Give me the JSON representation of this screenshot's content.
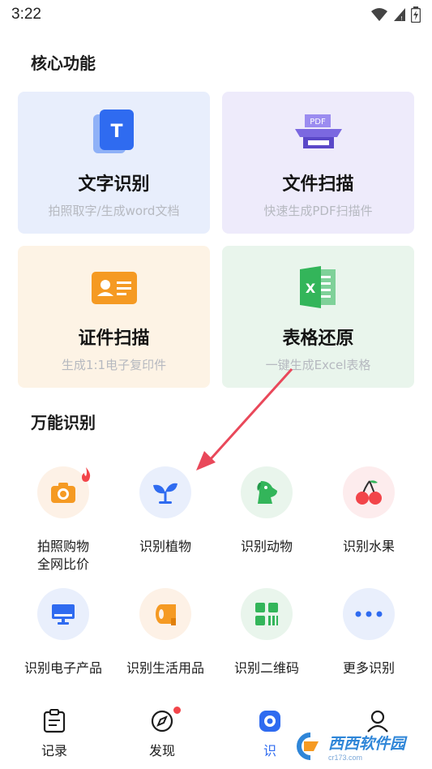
{
  "status": {
    "time": "3:22"
  },
  "core": {
    "title": "核心功能",
    "cards": [
      {
        "title": "文字识别",
        "sub": "拍照取字/生成word文档",
        "bg": "#e8eefc",
        "icon": "text-recognition-icon"
      },
      {
        "title": "文件扫描",
        "sub": "快速生成PDF扫描件",
        "bg": "#eeebfb",
        "icon": "pdf-scanner-icon",
        "badge": "PDF"
      },
      {
        "title": "证件扫描",
        "sub": "生成1:1电子复印件",
        "bg": "#fdf3e5",
        "icon": "id-card-icon"
      },
      {
        "title": "表格还原",
        "sub": "一键生成Excel表格",
        "bg": "#e9f5ec",
        "icon": "excel-icon",
        "badge": "X"
      }
    ]
  },
  "universal": {
    "title": "万能识别",
    "items": [
      {
        "label": "拍照购物\n全网比价",
        "circle": "#fdf1e6",
        "icon": "camera-icon"
      },
      {
        "label": "识别植物",
        "circle": "#e9effc",
        "icon": "plant-icon"
      },
      {
        "label": "识别动物",
        "circle": "#e9f5ec",
        "icon": "dog-icon"
      },
      {
        "label": "识别水果",
        "circle": "#fdeced",
        "icon": "cherry-icon"
      },
      {
        "label": "识别电子产品",
        "circle": "#e9effc",
        "icon": "monitor-icon"
      },
      {
        "label": "识别生活用品",
        "circle": "#fdf1e6",
        "icon": "tissue-roll-icon"
      },
      {
        "label": "识别二维码",
        "circle": "#e9f5ec",
        "icon": "qr-code-icon"
      },
      {
        "label": "更多识别",
        "circle": "#e9effc",
        "icon": "more-dots-icon"
      }
    ]
  },
  "nav": {
    "items": [
      {
        "label": "记录",
        "icon": "record-icon"
      },
      {
        "label": "发现",
        "icon": "compass-icon"
      },
      {
        "label": "识",
        "icon": "scan-icon"
      },
      {
        "label": "",
        "icon": "user-icon"
      }
    ]
  },
  "watermark": {
    "text": "西西软件园",
    "sub": "cr173.com"
  },
  "colors": {
    "blue": "#2f6bf0",
    "orange": "#f59a23",
    "green": "#33b55a",
    "red": "#f2454a",
    "purple": "#7b68e0",
    "arrow": "#e9485a"
  }
}
